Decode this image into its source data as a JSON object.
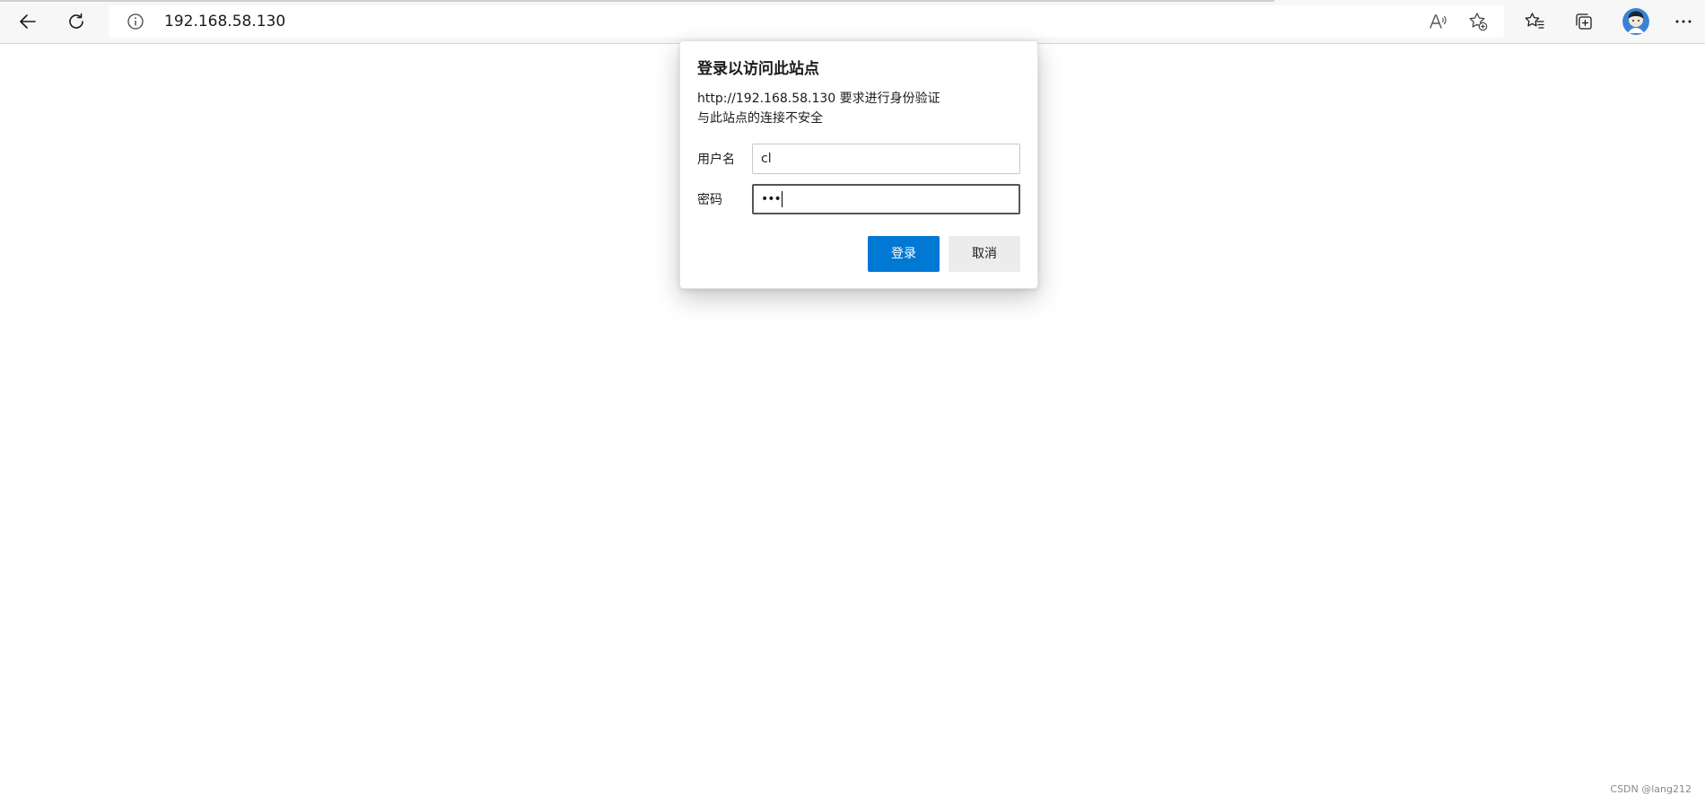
{
  "browser": {
    "address_bar": {
      "url": "192.168.58.130"
    },
    "icons": {
      "back": "back-arrow-icon",
      "refresh": "refresh-icon",
      "site_info": "info-icon",
      "read_aloud": "read-aloud-icon",
      "add_favorite": "add-favorite-icon",
      "favorites": "favorites-icon",
      "collections": "collections-icon",
      "profile": "avatar",
      "more": "more-menu-icon"
    },
    "colors": {
      "toolbar_bg": "#f7f7f7",
      "accent": "#0078d4"
    }
  },
  "auth_dialog": {
    "title": "登录以访问此站点",
    "message_line1": "http://192.168.58.130 要求进行身份验证",
    "message_line2": "与此站点的连接不安全",
    "username_label": "用户名",
    "username_value": "cl",
    "password_label": "密码",
    "password_masked": "•••",
    "login_button": "登录",
    "cancel_button": "取消"
  },
  "watermark": "CSDN @lang212"
}
